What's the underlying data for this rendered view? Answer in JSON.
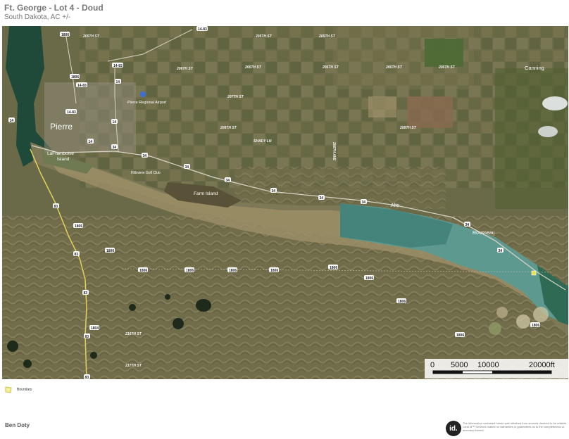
{
  "header": {
    "title": "Ft. George - Lot 4 - Doud",
    "subtitle": "South Dakota,  AC +/-"
  },
  "map": {
    "places": [
      {
        "id": "pierre",
        "text": "Pierre"
      },
      {
        "id": "laframboise",
        "text": "LaFramboise"
      },
      {
        "id": "island",
        "text": "Island"
      },
      {
        "id": "farm-island",
        "text": "Farm Island"
      },
      {
        "id": "canning",
        "text": "Canning"
      },
      {
        "id": "alto",
        "text": "Alto"
      },
      {
        "id": "rousseau",
        "text": "Rousseau"
      },
      {
        "id": "airport",
        "text": "Pierre Regional Airport"
      },
      {
        "id": "golf",
        "text": "Hillsview Golf Club"
      }
    ],
    "roads": [
      {
        "id": "205th-st-a",
        "text": "205TH ST"
      },
      {
        "id": "205th-st-b",
        "text": "205TH ST"
      },
      {
        "id": "205th-st-c",
        "text": "205TH ST"
      },
      {
        "id": "206th-st-a",
        "text": "206TH ST"
      },
      {
        "id": "206th-st-b",
        "text": "206TH ST"
      },
      {
        "id": "206th-st-c",
        "text": "206TH ST"
      },
      {
        "id": "206th-st-d",
        "text": "206TH ST"
      },
      {
        "id": "206th-st-e",
        "text": "206TH ST"
      },
      {
        "id": "207th-st",
        "text": "207TH ST"
      },
      {
        "id": "208th-st-a",
        "text": "208TH ST"
      },
      {
        "id": "208th-st-b",
        "text": "208TH ST"
      },
      {
        "id": "shady-ln",
        "text": "SHADY LN"
      },
      {
        "id": "216th-st",
        "text": "216TH ST"
      },
      {
        "id": "217th-st",
        "text": "217TH ST"
      },
      {
        "id": "286th-ave",
        "text": "286TH AVE"
      }
    ],
    "shields": {
      "s1483": "14-83",
      "s14": "14",
      "s34": "34",
      "s83": "83",
      "s1806": "1806",
      "s1804": "1804"
    }
  },
  "scale": {
    "labels": [
      "0",
      "5000",
      "10000",
      "20000ft"
    ]
  },
  "legend": {
    "label": "Boundary"
  },
  "footer": {
    "author": "Ben Doty",
    "logo": "id.",
    "disclaimer": "The information contained herein was obtained from sources deemed to be reliable. Land id™ Services makes no warranties or guarantees as to the completeness or accuracy thereof."
  },
  "colors": {
    "water_deep": "#1f4a3a",
    "water_shallow": "#6fa8a0",
    "land": "#6b6a48",
    "boundary": "#e8e14a"
  }
}
